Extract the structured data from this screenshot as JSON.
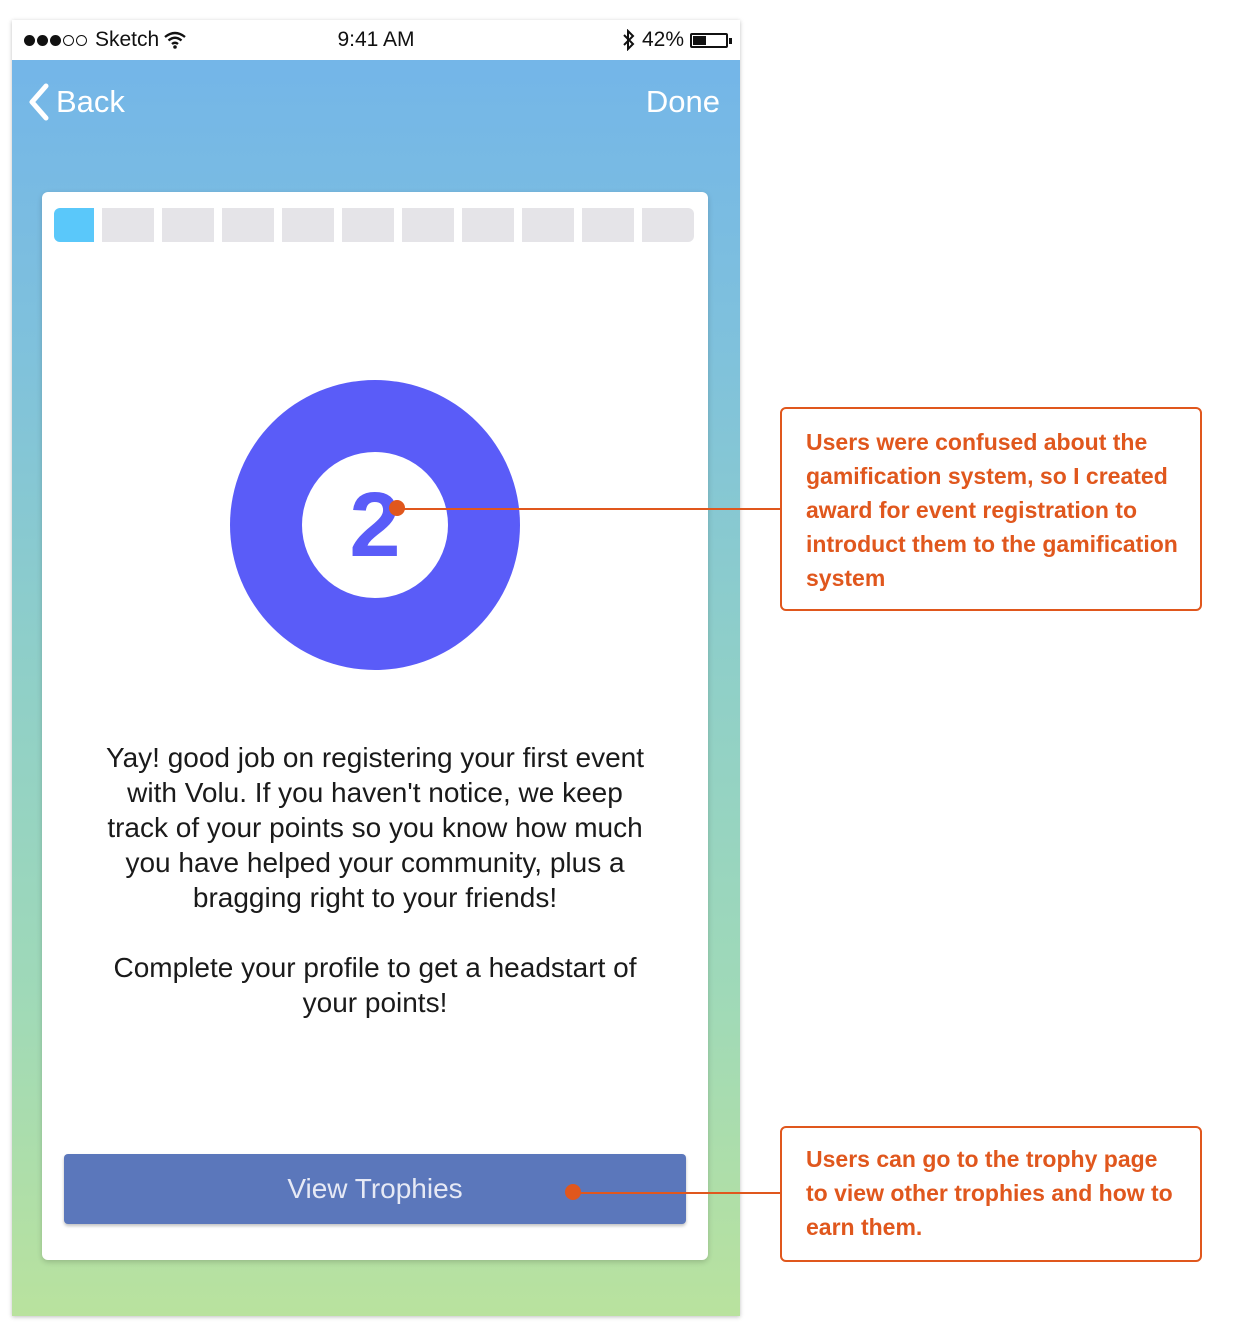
{
  "status_bar": {
    "carrier": "Sketch",
    "time": "9:41 AM",
    "battery": "42%",
    "battery_level": 0.42
  },
  "nav": {
    "back_label": "Back",
    "done_label": "Done"
  },
  "progress": {
    "total_steps": 11,
    "current_step": 1
  },
  "award": {
    "number": "2"
  },
  "message": {
    "paragraph1": "Yay! good job on registering your first event with Volu. If you haven't notice, we keep track of your points so you know how much you have helped your community, plus a bragging right to your friends!",
    "paragraph2": "Complete your profile to get a headstart of your points!"
  },
  "button": {
    "label": "View Trophies"
  },
  "annotations": {
    "note1": "Users were confused about the gamification system, so I created award for event registration to introduct them to the gamification system",
    "note2": "Users can go to the trophy page to view other trophies and how to earn them."
  },
  "colors": {
    "accent": "#e0571d",
    "award": "#5a5cf8",
    "button": "#5b77bb",
    "progress_active": "#5ac8fa"
  }
}
